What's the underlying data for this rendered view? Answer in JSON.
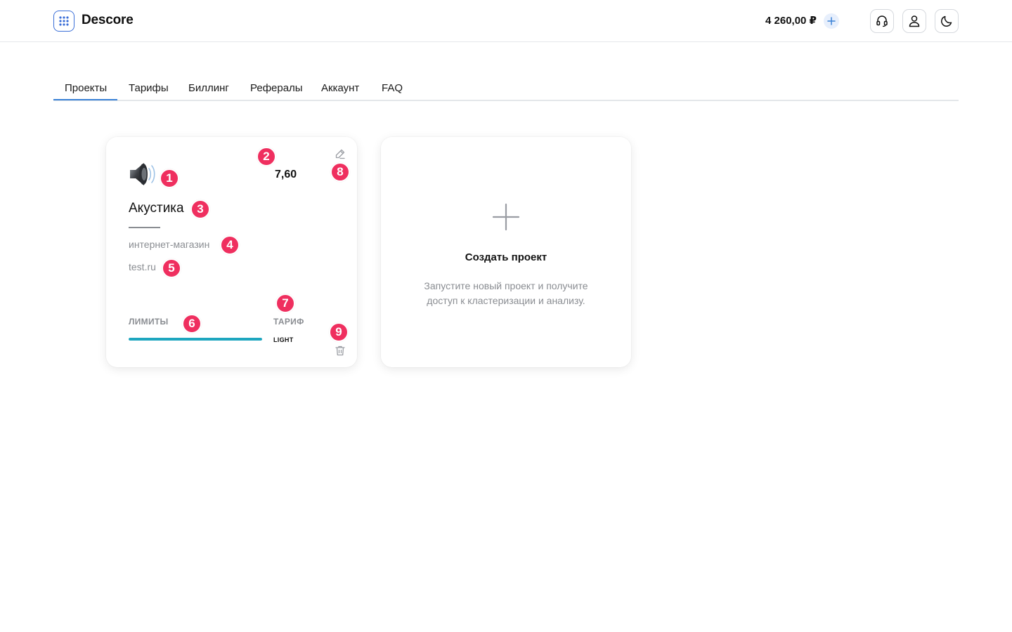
{
  "header": {
    "brand": "Descore",
    "balance": "4 260,00 ₽",
    "icons": {
      "logo": "grid-dots-icon",
      "add_balance": "plus-icon",
      "support": "headset-icon",
      "profile": "user-icon",
      "theme": "moon-icon"
    },
    "colors": {
      "accent": "#3b6fd8"
    }
  },
  "tabs": {
    "items": [
      {
        "label": "Проекты",
        "active": true
      },
      {
        "label": "Тарифы"
      },
      {
        "label": "Биллинг"
      },
      {
        "label": "Рефералы"
      },
      {
        "label": "Аккаунт"
      },
      {
        "label": "FAQ"
      }
    ],
    "active_color": "#3b82d6"
  },
  "project_card": {
    "icon": "speaker-icon",
    "score": "7,60",
    "name": "Акустика",
    "type": "интернет-магазин",
    "domain": "test.ru",
    "limits_label": "ЛИМИТЫ",
    "limits_progress": 1.0,
    "tariff_label": "ТАРИФ",
    "tariff_value": "LIGHT",
    "edit_icon": "pencil-icon",
    "delete_icon": "trash-icon",
    "progress_color": "#1ea6bf"
  },
  "create_card": {
    "icon": "plus-icon",
    "title": "Создать проект",
    "description": "Запустите новый проект и получите доступ к кластеризации и анализу."
  },
  "markers": {
    "color": "#ef2f5f",
    "labels": [
      "1",
      "2",
      "3",
      "4",
      "5",
      "6",
      "7",
      "8",
      "9"
    ]
  }
}
